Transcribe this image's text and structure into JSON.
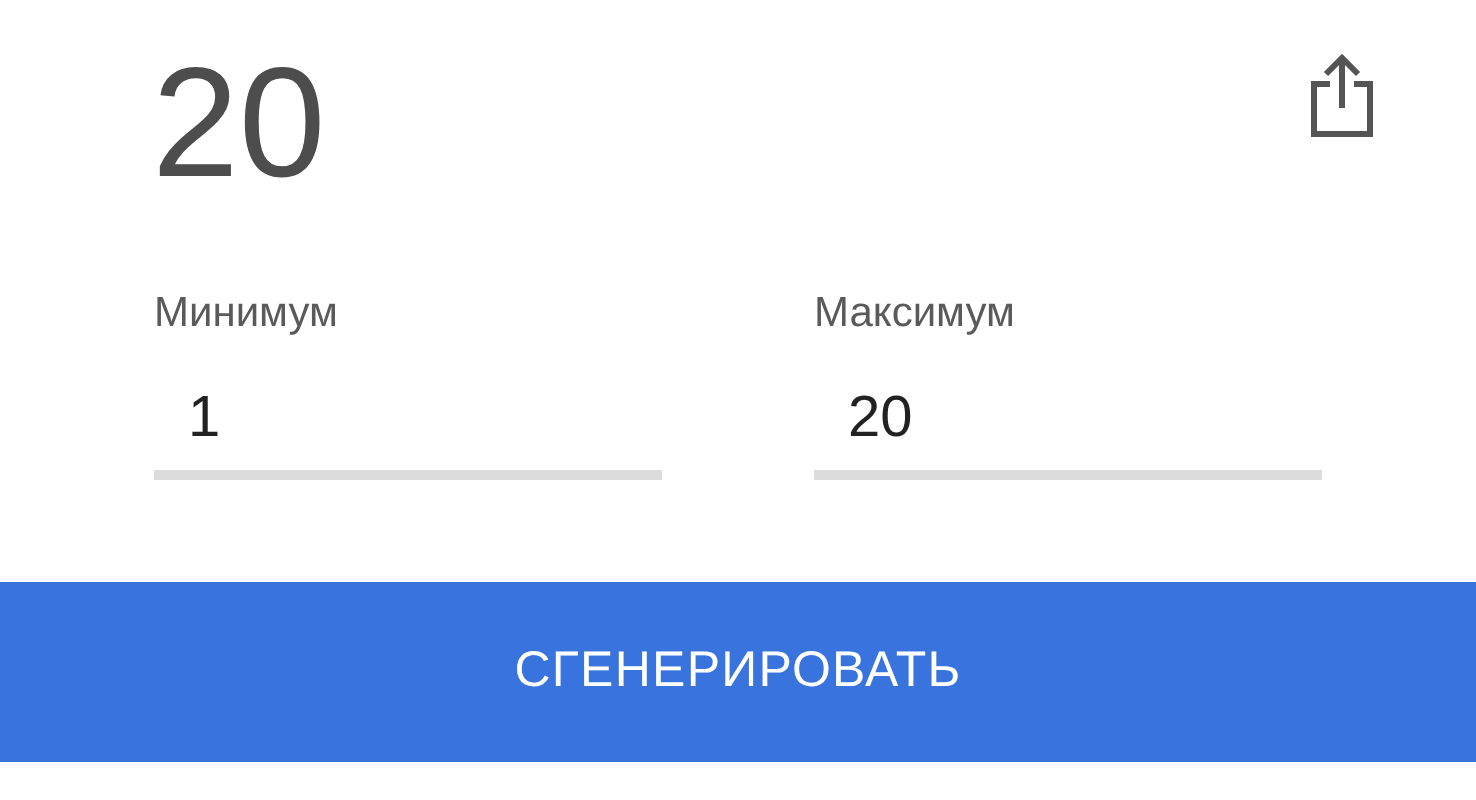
{
  "result": "20",
  "fields": [
    {
      "label": "Минимум",
      "value": "1"
    },
    {
      "label": "Максимум",
      "value": "20"
    }
  ],
  "button": "СГЕНЕРИРОВАТЬ"
}
